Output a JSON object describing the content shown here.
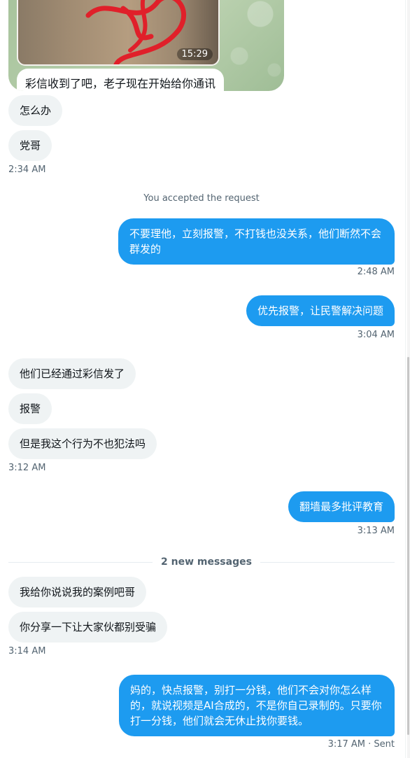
{
  "media_message": {
    "photo_time": "15:29",
    "caption": "彩信收到了吧，老子现在开始给你通讯"
  },
  "incoming_group_1": {
    "messages": [
      "怎么办",
      "党哥"
    ],
    "time": "2:34 AM"
  },
  "system_notice": "You accepted the request",
  "outgoing_1": {
    "text": "不要理他，立刻报警，不打钱也没关系，他们断然不会群发的",
    "time": "2:48 AM"
  },
  "outgoing_2": {
    "text": "优先报警，让民警解决问题",
    "time": "3:04 AM"
  },
  "incoming_group_2": {
    "messages": [
      "他们已经通过彩信发了",
      "报警",
      "但是我这个行为不也犯法吗"
    ],
    "time": "3:12 AM"
  },
  "outgoing_3": {
    "text": "翻墙最多批评教育",
    "time": "3:13 AM"
  },
  "new_messages_divider": "2 new messages",
  "incoming_group_3": {
    "messages": [
      "我给你说说我的案例吧哥",
      "你分享一下让大家伙都别受骗"
    ],
    "time": "3:14 AM"
  },
  "outgoing_4": {
    "text": "妈的，快点报警，别打一分钱，他们不会对你怎么样的，就说视频是AI合成的，不是你自己录制的。只要你打一分钱，他们就会无休止找你要钱。",
    "time": "3:17 AM · Sent"
  },
  "colors": {
    "outgoing_bubble": "#1d9bf0",
    "incoming_bubble": "#eff3f4",
    "timestamp": "#536471"
  }
}
